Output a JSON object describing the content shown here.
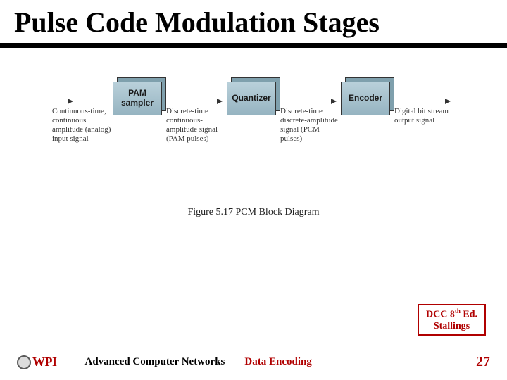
{
  "title": "Pulse Code Modulation Stages",
  "diagram": {
    "signals": [
      "Continuous-time, continuous amplitude (analog) input signal",
      "Discrete-time continuous-amplitude signal (PAM pulses)",
      "Discrete-time discrete-amplitude signal (PCM pulses)",
      "Digital bit stream output signal"
    ],
    "blocks": [
      "PAM sampler",
      "Quantizer",
      "Encoder"
    ],
    "caption": "Figure 5.17   PCM Block Diagram"
  },
  "source": {
    "line1_pre": "DCC 8",
    "line1_sup": "th",
    "line1_post": " Ed.",
    "line2": "Stallings"
  },
  "footer": {
    "logo_text": "WPI",
    "course": "Advanced Computer Networks",
    "topic": "Data Encoding",
    "page": "27"
  }
}
